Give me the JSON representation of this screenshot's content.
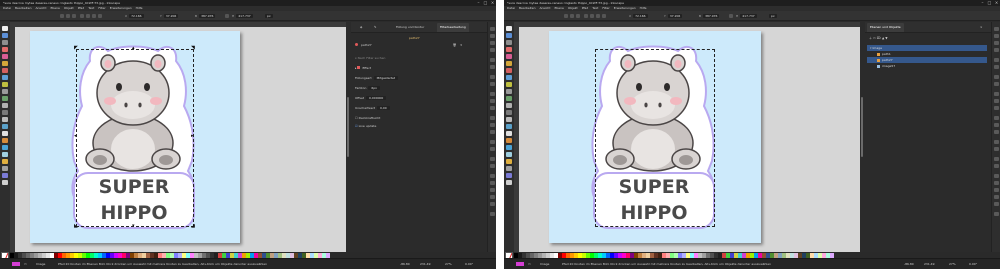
{
  "left_window": {
    "title": "*sure descrva mytee deseres-ceneso ringlesto thippo_4CWF-T3.jpg - Inkscape",
    "menu": [
      "Datei",
      "Bearbeiten",
      "Ansicht",
      "Ebene",
      "Objekt",
      "Pfad",
      "Text",
      "Filter",
      "Erweiterungen",
      "Hilfe"
    ],
    "controls": {
      "x_label": "X",
      "x_value": "72.166",
      "y_label": "Y",
      "y_value": "37.206",
      "w_label": "B",
      "w_value": "387.976",
      "h_label": "H",
      "h_value": "417.737",
      "unit": "px"
    },
    "panel": {
      "tabs": [
        "",
        "",
        "Füllung und Kontur",
        "Filterbearbeitung"
      ],
      "object_id": "path27",
      "filter_search_placeholder": "Nach Filter suchen",
      "effect_label": "Effect",
      "props": [
        {
          "label": "Füllungsart",
          "value": "Mitgestartet"
        },
        {
          "label": "Farbton",
          "value": "6px"
        },
        {
          "label": "Offset",
          "value": "0,000000"
        },
        {
          "label": "Unscharfwert",
          "value": "0,00"
        }
      ],
      "checkbox_1": "Deckkraftsicht",
      "checkbox_2": "Live update"
    },
    "status": {
      "layer_label": "Image",
      "path_text": "Pfad 20 Knoten im Ebenen Bild. Klick drücken um Auswahl mit mehrere Knoten zu bearbeiten, Alt+Klick um Objekte darunter auszuwählen",
      "x_readout": "-86.80",
      "y_readout": "231.49",
      "zoom": "27%",
      "rotation": "0.00°"
    },
    "sticker": {
      "line1": "SUPER",
      "line2": "HIPPO"
    }
  },
  "right_window": {
    "title": "*sure descrva mytee deseres-ceneso ringlesto thippo_4CWF-T3.jpg - Inkscape",
    "menu": [
      "Datei",
      "Bearbeiten",
      "Ansicht",
      "Ebene",
      "Objekt",
      "Pfad",
      "Text",
      "Filter",
      "Erweiterungen",
      "Hilfe"
    ],
    "controls": {
      "x_label": "X",
      "x_value": "72.166",
      "y_label": "Y",
      "y_value": "37.206",
      "w_label": "B",
      "w_value": "387.976",
      "h_label": "H",
      "h_value": "417.737",
      "unit": "px"
    },
    "panel": {
      "tab_label": "Ebenen und Objekte",
      "layers": [
        {
          "name": "Image",
          "selected": true
        },
        {
          "name": "path1",
          "selected": false
        },
        {
          "name": "path27",
          "selected": true
        },
        {
          "name": "image57",
          "selected": false
        }
      ]
    },
    "status": {
      "layer_label": "Image",
      "path_text": "Pfad 20 Knoten im Ebenen Bild. Klick drücken um Auswahl mit mehrere Knoten zu bearbeiten, Alt+Klick um Objekte darunter auszuwählen",
      "x_readout": "-86.80",
      "y_readout": "231.49",
      "zoom": "27%",
      "rotation": "0.00°"
    },
    "sticker": {
      "line1": "SUPER",
      "line2": "HIPPO"
    }
  },
  "colors": {
    "page": "#cdeafb",
    "canvas": "#d6d6d6",
    "ui_dark": "#2b2b2b",
    "selection_blue": "#35588c",
    "hippo_body": "#d9d4d2",
    "hippo_outline": "#4a4545",
    "cheek": "#f2b8bf",
    "sticker_border": "#ffffff",
    "sticker_glow": "#b9a9f0",
    "text_fill": "#4a4a4a"
  },
  "palette": [
    "#000000",
    "#1a1a1a",
    "#333333",
    "#4d4d4d",
    "#666666",
    "#808080",
    "#999999",
    "#b3b3b3",
    "#cccccc",
    "#e6e6e6",
    "#ffffff",
    "#800000",
    "#ff0000",
    "#ff6600",
    "#ff9900",
    "#ffcc00",
    "#ffff00",
    "#ccff00",
    "#66ff00",
    "#00ff00",
    "#00ff66",
    "#00ffcc",
    "#00ccff",
    "#0066ff",
    "#0000ff",
    "#6600ff",
    "#cc00ff",
    "#ff00cc",
    "#ff0066",
    "#800080",
    "#804000",
    "#c08040",
    "#e0b080",
    "#f0d0a0",
    "#a06040",
    "#603020",
    "#402010",
    "#ff8080",
    "#ffb0b0",
    "#80ff80",
    "#b0ffb0",
    "#8080ff",
    "#b0b0ff",
    "#ffff80",
    "#80ffff",
    "#ff80ff",
    "#c0c0c0",
    "#a0a0a0",
    "#707070",
    "#505050",
    "#303030",
    "#202020",
    "#d04040",
    "#40d040",
    "#4040d0",
    "#d0d040",
    "#40d0d0",
    "#d040d0",
    "#f0a000",
    "#a0f000",
    "#00a0f0",
    "#f000a0",
    "#905030",
    "#305090",
    "#509030",
    "#c0a080",
    "#80a0c0",
    "#a0c080",
    "#e0e0c0",
    "#c0e0e0",
    "#e0c0e0",
    "#604020",
    "#204060",
    "#406020",
    "#ffddaa",
    "#aaddff",
    "#ddffaa",
    "#ffaadd",
    "#aaffdd",
    "#ddaaff"
  ],
  "icons": {
    "no_paint": "no-paint-icon",
    "minimize": "minimize-icon",
    "maximize": "maximize-icon",
    "close": "close-icon"
  }
}
